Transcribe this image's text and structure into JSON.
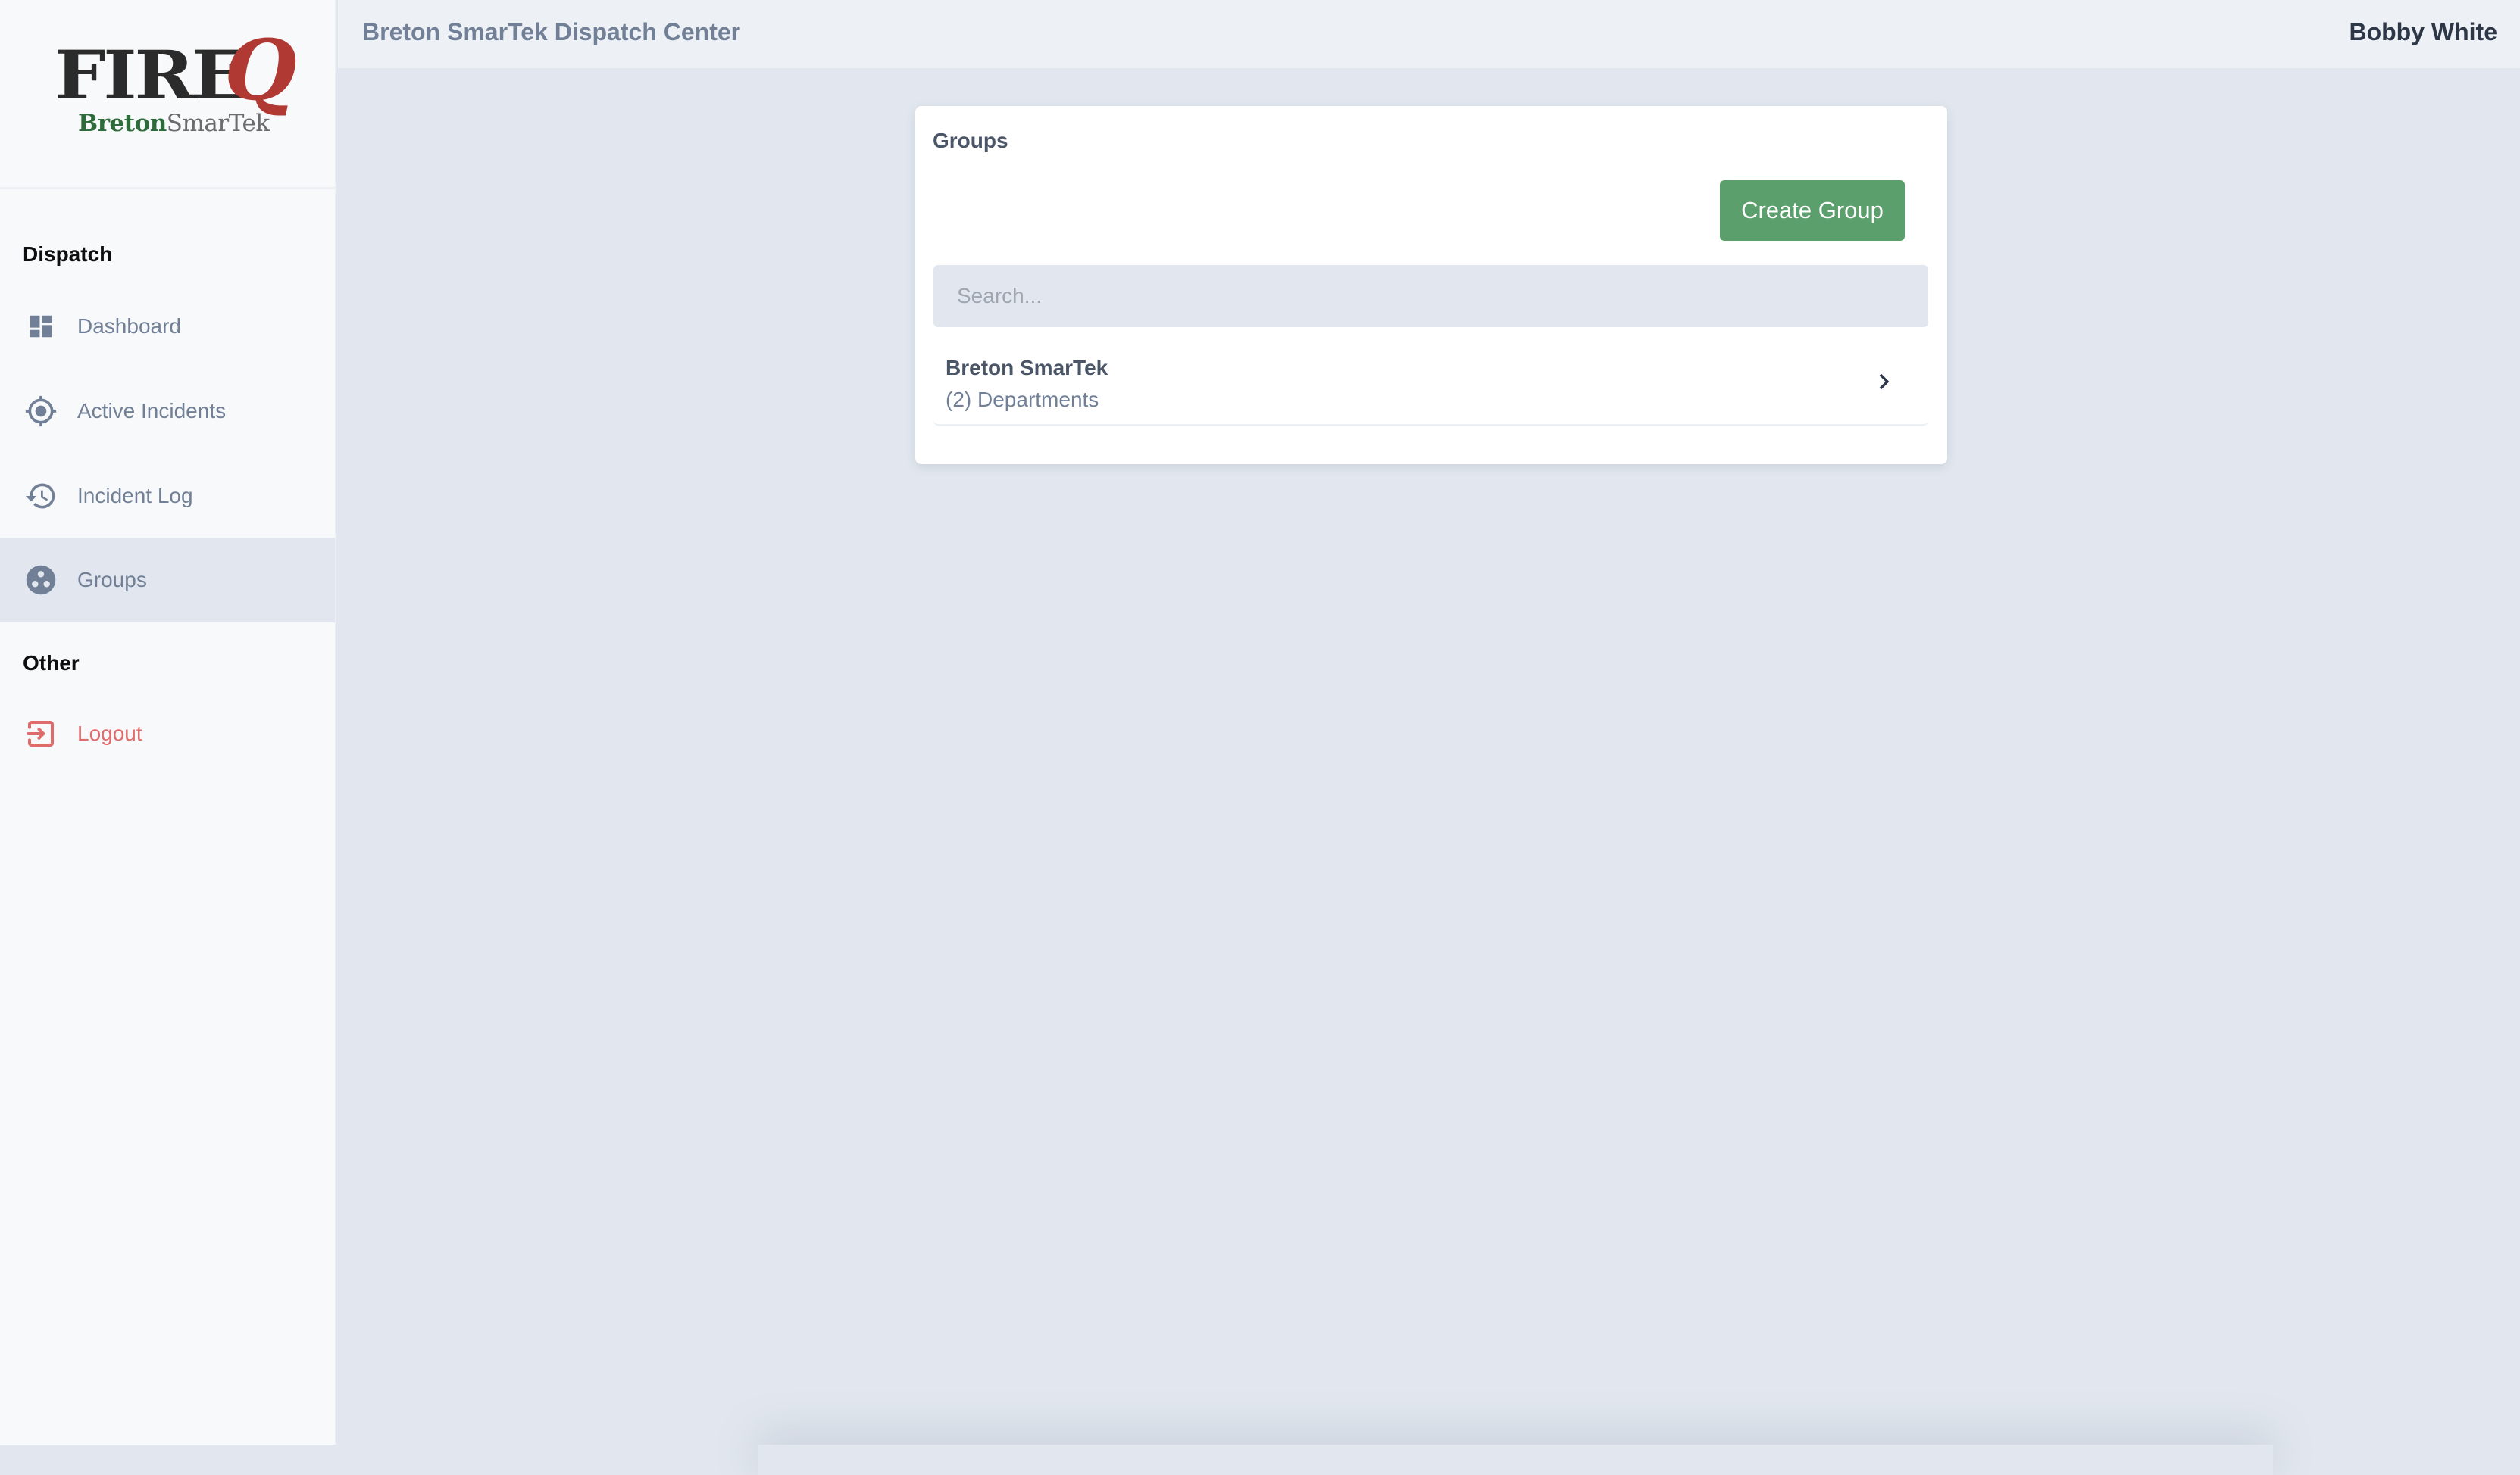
{
  "logo": {
    "main": "FIRE",
    "accent": "Q",
    "sub_bold": "Breton",
    "sub_light": "SmarTek",
    "colors": {
      "main": "#2b2b2b",
      "accent": "#b03a33",
      "sub_bold": "#2e6b3a"
    }
  },
  "header": {
    "title": "Breton SmarTek Dispatch Center",
    "user": "Bobby White"
  },
  "sidebar": {
    "sections": [
      {
        "heading": "Dispatch",
        "items": [
          {
            "label": "Dashboard",
            "icon": "dashboard-icon",
            "active": false
          },
          {
            "label": "Active Incidents",
            "icon": "crosshair-icon",
            "active": false
          },
          {
            "label": "Incident Log",
            "icon": "history-icon",
            "active": false
          },
          {
            "label": "Groups",
            "icon": "groups-icon",
            "active": true
          }
        ]
      },
      {
        "heading": "Other",
        "items": [
          {
            "label": "Logout",
            "icon": "logout-icon",
            "active": false
          }
        ]
      }
    ]
  },
  "main": {
    "card_title": "Groups",
    "create_button": "Create Group",
    "search": {
      "placeholder": "Search...",
      "value": ""
    },
    "groups": [
      {
        "name": "Breton SmarTek",
        "subtitle": "(2) Departments"
      }
    ]
  },
  "colors": {
    "accent_green": "#5b9f6d",
    "logout_red": "#e06b6b",
    "muted_text": "#718096",
    "active_bg": "#e2e7ef"
  }
}
